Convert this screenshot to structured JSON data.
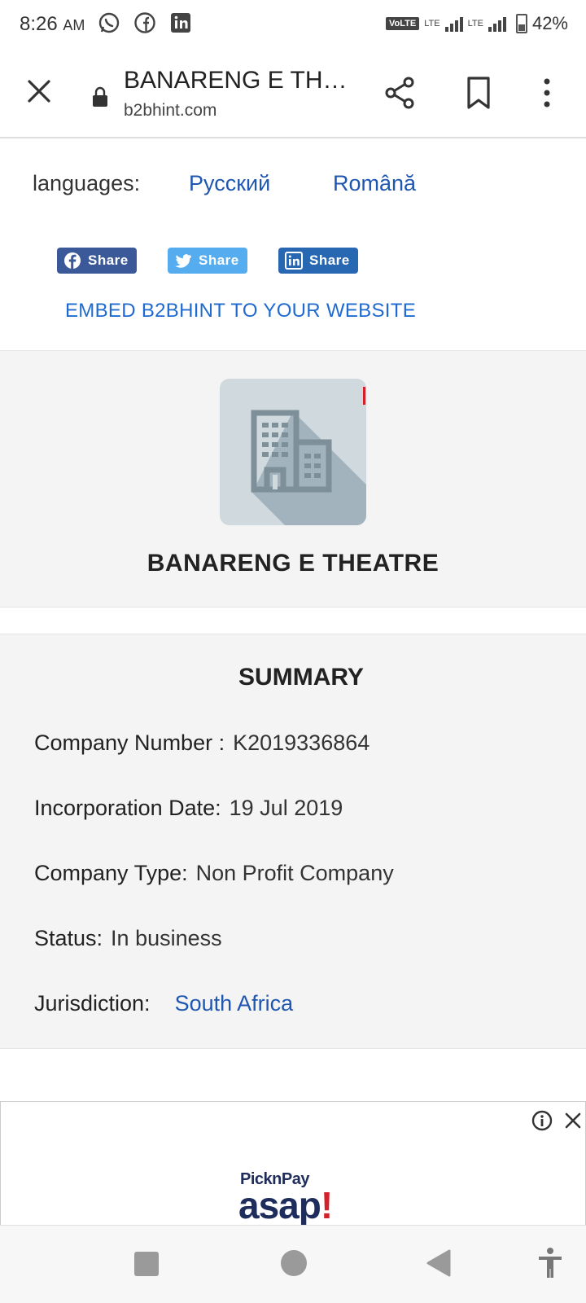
{
  "status_bar": {
    "time": "8:26",
    "ampm": "AM",
    "volte": "VoLTE",
    "lte1": "LTE",
    "lte2": "LTE",
    "battery": "42%",
    "icons": [
      "whatsapp-icon",
      "facebook-icon",
      "linkedin-icon"
    ]
  },
  "toolbar": {
    "title": "BANARENG E TH…",
    "url": "b2bhint.com",
    "icons": [
      "close-icon",
      "lock-icon",
      "share-icon",
      "bookmark-icon",
      "more-icon"
    ]
  },
  "languages": {
    "label": "languages:",
    "items": [
      "Русский",
      "Română"
    ]
  },
  "social_share": [
    {
      "network": "facebook",
      "label": "Share",
      "color": "#3b5998"
    },
    {
      "network": "twitter",
      "label": "Share",
      "color": "#55acee"
    },
    {
      "network": "linkedin",
      "label": "Share",
      "color": "#2867b2"
    }
  ],
  "embed_link": "EMBED B2BHINT TO YOUR WEBSITE",
  "company": {
    "name": "BANARENG E THEATRE",
    "icon": "building-icon"
  },
  "summary": {
    "title": "SUMMARY",
    "company_number_label": "Company Number :",
    "company_number": "K2019336864",
    "incorporation_label": "Incorporation Date:",
    "incorporation_date": "19 Jul 2019",
    "type_label": "Company Type:",
    "type": "Non Profit Company",
    "status_label": "Status:",
    "status": "In business",
    "jurisdiction_label": "Jurisdiction:",
    "jurisdiction": "South Africa"
  },
  "ad": {
    "brand_top": "PicknPay",
    "brand_main": "asap",
    "brand_bang": "!",
    "icons": [
      "info-icon",
      "close-icon"
    ]
  },
  "nav_bar": {
    "icons": [
      "recents-icon",
      "home-icon",
      "back-icon",
      "accessibility-icon"
    ]
  },
  "colors": {
    "link": "#1f57b0",
    "card_bg": "#f4f4f4",
    "brand_navy": "#1e2d5c",
    "brand_red": "#d4202a"
  }
}
